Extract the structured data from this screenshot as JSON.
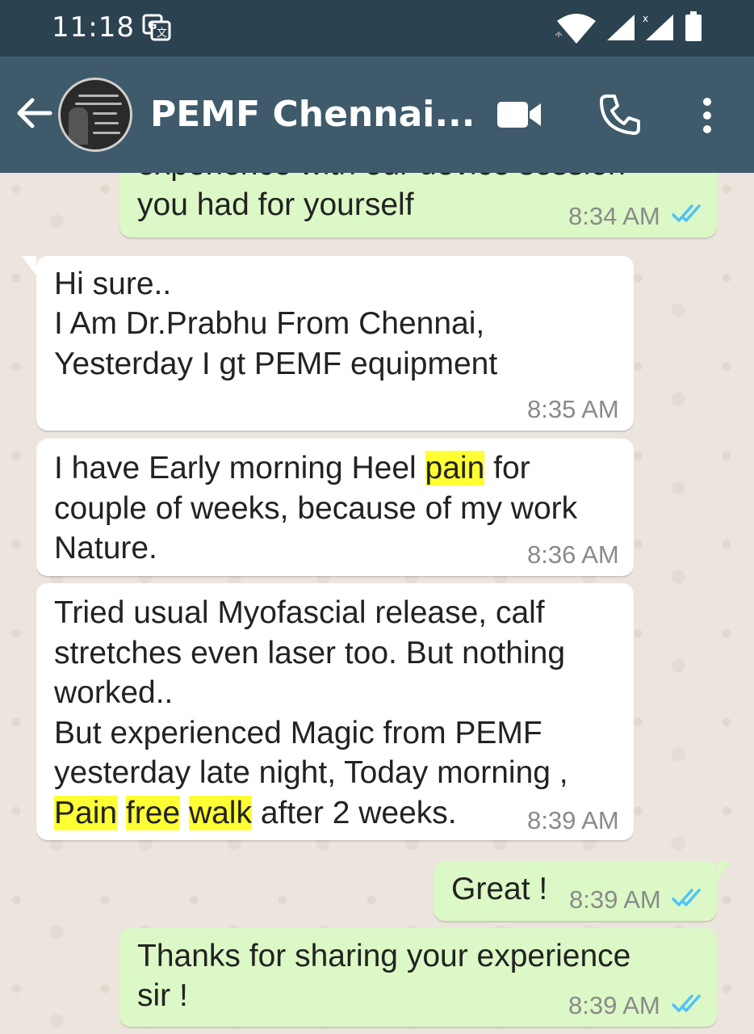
{
  "status_bar": {
    "time": "11:18",
    "icons": [
      "translate-icon",
      "wifi-icon",
      "signal-icon",
      "signal-icon",
      "battery-icon"
    ]
  },
  "header": {
    "title": "PEMF Chennai...",
    "icons": [
      "back-arrow-icon",
      "avatar",
      "video-call-icon",
      "phone-call-icon",
      "more-options-icon"
    ]
  },
  "colors": {
    "status_bar": "#2B4250",
    "header": "#3F5A6A",
    "chat_background": "#ECE5DD",
    "incoming_bubble": "#FFFFFF",
    "outgoing_bubble": "#DCF8C6",
    "highlight": "#FFFF33",
    "read_ticks": "#4FC3F7"
  },
  "messages": [
    {
      "direction": "outgoing",
      "lines": [
        "experience with our device session",
        "you had for yourself"
      ],
      "time": "8:34 AM",
      "status": "read"
    },
    {
      "direction": "incoming",
      "lines": [
        "Hi sure..",
        "I Am Dr.Prabhu From Chennai,",
        "Yesterday I gt PEMF equipment"
      ],
      "time": "8:35 AM"
    },
    {
      "direction": "incoming",
      "segments": [
        {
          "text": "I have Early morning Heel "
        },
        {
          "text": "pain",
          "highlight": true
        },
        {
          "text": " for\ncouple of weeks, because of my work\nNature."
        }
      ],
      "time": "8:36 AM"
    },
    {
      "direction": "incoming",
      "segments": [
        {
          "text": "Tried usual Myofascial release, calf\nstretches even laser too. But nothing\nworked..\nBut experienced Magic from PEMF\nyesterday late night, Today morning ,\n"
        },
        {
          "text": "Pain",
          "highlight": true
        },
        {
          "text": " "
        },
        {
          "text": "free",
          "highlight": true
        },
        {
          "text": " "
        },
        {
          "text": "walk",
          "highlight": true
        },
        {
          "text": " after 2 weeks."
        }
      ],
      "time": "8:39 AM"
    },
    {
      "direction": "outgoing",
      "lines": [
        "Great !"
      ],
      "time": "8:39 AM",
      "status": "read"
    },
    {
      "direction": "outgoing",
      "lines": [
        "Thanks for sharing your experience",
        "sir !"
      ],
      "time": "8:39 AM",
      "status": "read"
    }
  ]
}
